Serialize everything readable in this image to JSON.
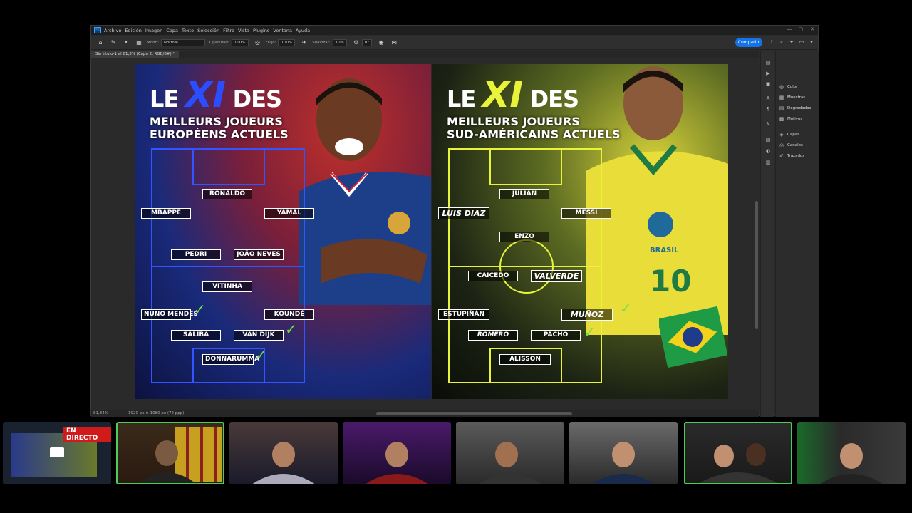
{
  "app": {
    "logo_label": "Ps",
    "menu": [
      "Archivo",
      "Edición",
      "Imagen",
      "Capa",
      "Texto",
      "Selección",
      "Filtro",
      "Vista",
      "Plugins",
      "Ventana",
      "Ayuda"
    ],
    "window_buttons": [
      "—",
      "▢",
      "✕"
    ]
  },
  "options_bar": {
    "mode_label": "Modo:",
    "mode_value": "Normal",
    "opacity_label": "Opacidad:",
    "opacity_value": "100%",
    "flow_label": "Flujo:",
    "flow_value": "100%",
    "smoothing_label": "Suavizar:",
    "smoothing_value": "10%",
    "angle_value": "0°",
    "share_label": "Compartir"
  },
  "document_tab": {
    "label": "Sin título-1 al 81,3% (Capa 2, RGB/8#) *"
  },
  "status_bar": {
    "zoom": "81,34%",
    "doc_info": "1920 px × 1080 px (72 ppp)"
  },
  "panels": {
    "items": [
      {
        "label": "Color",
        "icon": "palette-icon"
      },
      {
        "label": "Muestras",
        "icon": "swatches-icon"
      },
      {
        "label": "Degradados",
        "icon": "gradient-icon"
      },
      {
        "label": "Motivos",
        "icon": "pattern-icon"
      },
      {
        "label": "Capas",
        "icon": "layers-icon"
      },
      {
        "label": "Canales",
        "icon": "channels-icon"
      },
      {
        "label": "Trazados",
        "icon": "paths-icon"
      }
    ]
  },
  "artboard": {
    "left": {
      "title_le": "LE",
      "title_xi": "XI",
      "title_des": "DES",
      "subtitle_1": "MEILLEURS JOUEURS",
      "subtitle_2": "EUROPÉENS ACTUELS",
      "accent": "#2a4dff",
      "players": {
        "ronaldo": "RONALDO",
        "mbappe": "MBAPPÉ",
        "yamal": "YAMAL",
        "pedri": "PEDRI",
        "joao_neves": "JOÃO NEVES",
        "vitinha": "VITINHA",
        "nuno_mendes": "NUNO MENDES",
        "kounde": "KOUNDÉ",
        "saliba": "SALIBA",
        "van_dijk": "VAN DIJK",
        "donnarumma": "DONNARUMMA"
      }
    },
    "right": {
      "title_le": "LE",
      "title_xi": "XI",
      "title_des": "DES",
      "subtitle_1": "MEILLEURS JOUEURS",
      "subtitle_2": "SUD-AMÉRICAINS ACTUELS",
      "accent": "#e8f43a",
      "shirt_text": "BRASIL",
      "shirt_number": "10",
      "players": {
        "julian": "JULIAN",
        "luis_diaz": "LUIS DIAZ",
        "messi": "MESSI",
        "enzo": "ENZO",
        "caicedo": "CAICEDO",
        "valverde": "VALVERDE",
        "estupinan": "ESTUPIÑÁN",
        "munoz": "MUÑOZ",
        "romero": "ROMERO",
        "pacho": "PACHO",
        "alisson": "ALISSON"
      }
    }
  },
  "stream": {
    "live_badge": "EN DIRECTO",
    "cams": [
      "cam-1",
      "cam-2",
      "cam-3",
      "cam-4",
      "cam-5",
      "cam-6",
      "cam-7",
      "cam-8"
    ]
  }
}
